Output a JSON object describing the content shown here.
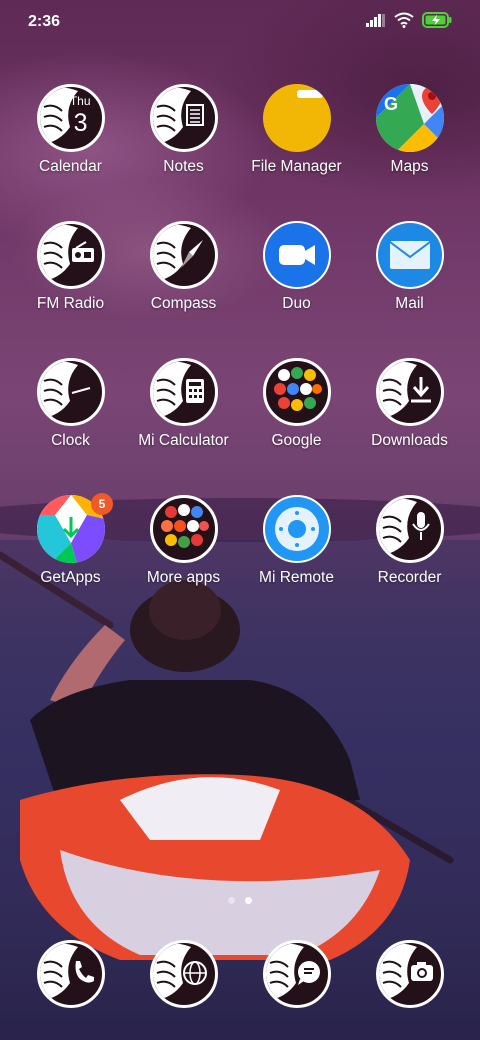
{
  "status": {
    "time": "2:36"
  },
  "apps": [
    {
      "label": "Calendar",
      "icon": "calendar-icon",
      "day": "Thu",
      "date": "3"
    },
    {
      "label": "Notes",
      "icon": "notes-icon"
    },
    {
      "label": "File Manager",
      "icon": "folder-icon"
    },
    {
      "label": "Maps",
      "icon": "maps-icon"
    },
    {
      "label": "FM Radio",
      "icon": "radio-icon"
    },
    {
      "label": "Compass",
      "icon": "compass-icon"
    },
    {
      "label": "Duo",
      "icon": "video-camera-icon"
    },
    {
      "label": "Mail",
      "icon": "mail-icon"
    },
    {
      "label": "Clock",
      "icon": "clock-icon"
    },
    {
      "label": "Mi Calculator",
      "icon": "calculator-icon"
    },
    {
      "label": "Google",
      "icon": "google-folder-icon"
    },
    {
      "label": "Downloads",
      "icon": "download-icon"
    },
    {
      "label": "GetApps",
      "icon": "getapps-icon",
      "badge": "5"
    },
    {
      "label": "More apps",
      "icon": "more-apps-folder-icon"
    },
    {
      "label": "Mi Remote",
      "icon": "remote-icon"
    },
    {
      "label": "Recorder",
      "icon": "microphone-icon"
    }
  ],
  "dock": [
    {
      "icon": "phone-icon"
    },
    {
      "icon": "browser-globe-icon"
    },
    {
      "icon": "messages-icon"
    },
    {
      "icon": "camera-icon"
    }
  ],
  "pages": {
    "count": 2,
    "active": 2
  },
  "colors": {
    "file_manager": "#f2b705",
    "duo": "#1a73e8",
    "mail": "#1e88e5",
    "mi_remote": "#2196f3",
    "badge": "#f05a28"
  }
}
